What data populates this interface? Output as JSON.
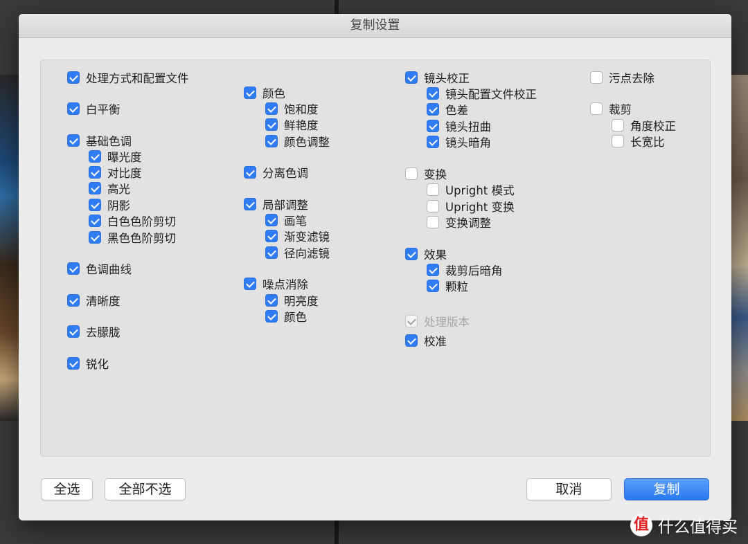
{
  "dialog": {
    "title": "复制设置"
  },
  "settings": [
    {
      "label": "处理方式和配置文件",
      "checked": true
    },
    {
      "label": "白平衡",
      "checked": true
    },
    {
      "label": "基础色调",
      "checked": true
    },
    {
      "label": "曝光度",
      "checked": true
    },
    {
      "label": "对比度",
      "checked": true
    },
    {
      "label": "高光",
      "checked": true
    },
    {
      "label": "阴影",
      "checked": true
    },
    {
      "label": "白色色阶剪切",
      "checked": true
    },
    {
      "label": "黑色色阶剪切",
      "checked": true
    },
    {
      "label": "色调曲线",
      "checked": true
    },
    {
      "label": "清晰度",
      "checked": true
    },
    {
      "label": "去朦胧",
      "checked": true
    },
    {
      "label": "锐化",
      "checked": true
    },
    {
      "label": "颜色",
      "checked": true
    },
    {
      "label": "饱和度",
      "checked": true
    },
    {
      "label": "鲜艳度",
      "checked": true
    },
    {
      "label": "颜色调整",
      "checked": true
    },
    {
      "label": "分离色调",
      "checked": true
    },
    {
      "label": "局部调整",
      "checked": true
    },
    {
      "label": "画笔",
      "checked": true
    },
    {
      "label": "渐变滤镜",
      "checked": true
    },
    {
      "label": "径向滤镜",
      "checked": true
    },
    {
      "label": "噪点消除",
      "checked": true
    },
    {
      "label": "明亮度",
      "checked": true
    },
    {
      "label": "颜色",
      "checked": true
    },
    {
      "label": "镜头校正",
      "checked": true
    },
    {
      "label": "镜头配置文件校正",
      "checked": true
    },
    {
      "label": "色差",
      "checked": true
    },
    {
      "label": "镜头扭曲",
      "checked": true
    },
    {
      "label": "镜头暗角",
      "checked": true
    },
    {
      "label": "变换",
      "checked": false
    },
    {
      "label": "Upright 模式",
      "checked": false
    },
    {
      "label": "Upright 变换",
      "checked": false
    },
    {
      "label": "变换调整",
      "checked": false
    },
    {
      "label": "效果",
      "checked": true
    },
    {
      "label": "裁剪后暗角",
      "checked": true
    },
    {
      "label": "颗粒",
      "checked": true
    },
    {
      "label": "处理版本",
      "checked": true,
      "disabled": true
    },
    {
      "label": "校准",
      "checked": true
    },
    {
      "label": "污点去除",
      "checked": false
    },
    {
      "label": "裁剪",
      "checked": false
    },
    {
      "label": "角度校正",
      "checked": false
    },
    {
      "label": "长宽比",
      "checked": false
    }
  ],
  "buttons": {
    "select_all": "全选",
    "select_none": "全部不选",
    "cancel": "取消",
    "copy": "复制"
  },
  "watermark": {
    "icon_glyph": "值",
    "text": "什么值得买"
  },
  "colors": {
    "accent": "#2f7cf6",
    "panel": "#e2e2e2",
    "dialog": "#ececec"
  }
}
